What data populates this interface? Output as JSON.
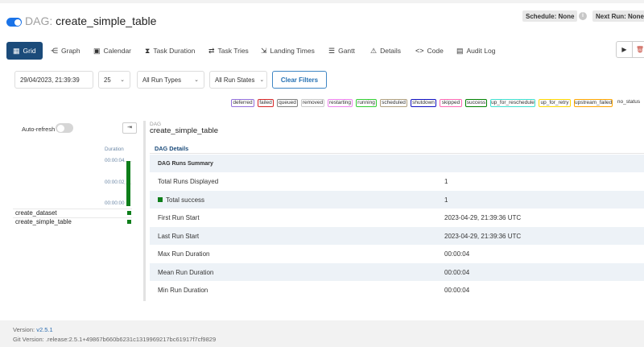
{
  "header": {
    "dag_prefix": "DAG:",
    "dag_id": "create_simple_table",
    "schedule": "Schedule: None",
    "next_run": "Next Run: None",
    "paused_toggle_on": true
  },
  "tabs": [
    {
      "label": "Grid",
      "icon": "grid-icon",
      "active": true
    },
    {
      "label": "Graph",
      "icon": "graph-icon"
    },
    {
      "label": "Calendar",
      "icon": "calendar-icon"
    },
    {
      "label": "Task Duration",
      "icon": "hourglass-icon"
    },
    {
      "label": "Task Tries",
      "icon": "retry-icon"
    },
    {
      "label": "Landing Times",
      "icon": "landing-icon"
    },
    {
      "label": "Gantt",
      "icon": "gantt-icon"
    },
    {
      "label": "Details",
      "icon": "warning-triangle-icon"
    },
    {
      "label": "Code",
      "icon": "code-icon"
    },
    {
      "label": "Audit Log",
      "icon": "document-icon"
    }
  ],
  "actions": {
    "trigger_icon": "play-icon",
    "delete_icon": "trash-icon"
  },
  "filters": {
    "base_date": "29/04/2023, 21:39:39",
    "num_runs": "25",
    "run_type": "All Run Types",
    "run_state": "All Run States",
    "clear_label": "Clear Filters"
  },
  "legend": [
    {
      "label": "deferred",
      "color": "#9370db"
    },
    {
      "label": "failed",
      "color": "#d62728"
    },
    {
      "label": "queued",
      "color": "#808080"
    },
    {
      "label": "removed",
      "color": "#c8c8c8"
    },
    {
      "label": "restarting",
      "color": "#ee82ee"
    },
    {
      "label": "running",
      "color": "#32cd32"
    },
    {
      "label": "scheduled",
      "color": "#b0a080"
    },
    {
      "label": "shutdown",
      "color": "#1010c0"
    },
    {
      "label": "skipped",
      "color": "#ff69b4"
    },
    {
      "label": "success",
      "color": "#008000"
    },
    {
      "label": "up_for_reschedule",
      "color": "#40e0d0"
    },
    {
      "label": "up_for_retry",
      "color": "#ffd700"
    },
    {
      "label": "upstream_failed",
      "color": "#ffa500"
    },
    {
      "label": "no_status",
      "color": "#ffffff"
    }
  ],
  "grid": {
    "auto_refresh_label": "Auto-refresh",
    "collapse_icon": "collapse-arrow-icon",
    "duration_label": "Duration",
    "ticks": [
      "00:00:04",
      "00:00:02",
      "00:00:00"
    ],
    "tasks": [
      "create_dataset",
      "create_simple_table"
    ],
    "run_state_color": "#0e7e1a"
  },
  "details": {
    "crumb": "DAG",
    "dag_name": "create_simple_table",
    "heading": "DAG Details",
    "summary_header": "DAG Runs Summary",
    "rows": [
      {
        "label": "Total Runs Displayed",
        "value": "1"
      },
      {
        "label": "Total success",
        "value": "1"
      },
      {
        "label": "First Run Start",
        "value": "2023-04-29, 21:39:36 UTC"
      },
      {
        "label": "Last Run Start",
        "value": "2023-04-29, 21:39:36 UTC"
      },
      {
        "label": "Max Run Duration",
        "value": "00:00:04"
      },
      {
        "label": "Mean Run Duration",
        "value": "00:00:04"
      },
      {
        "label": "Min Run Duration",
        "value": "00:00:04"
      }
    ]
  },
  "footer": {
    "version_label": "Version:",
    "version": "v2.5.1",
    "git_label": "Git Version:",
    "git_version": ".release:2.5.1+49867b660b6231c1319969217bc61917f7cf9829"
  }
}
